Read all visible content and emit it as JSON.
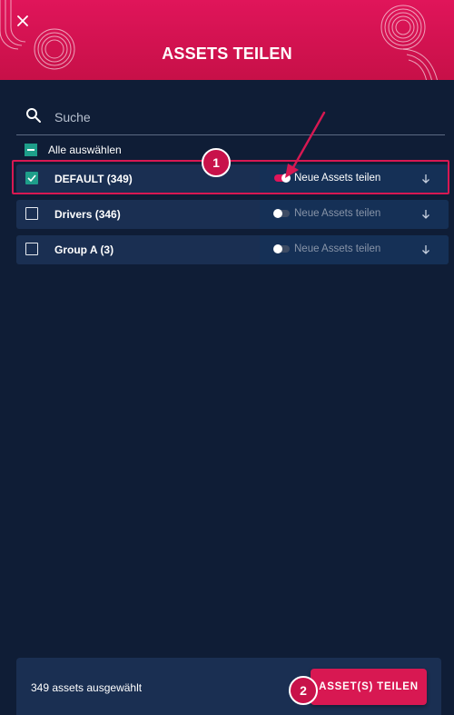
{
  "header": {
    "title": "ASSETS TEILEN",
    "close_icon": "close-icon",
    "accent": "#d81852"
  },
  "search": {
    "placeholder": "Suche",
    "value": ""
  },
  "select_all": {
    "label": "Alle auswählen",
    "state": "indeterminate"
  },
  "groups": [
    {
      "name": "DEFAULT (349)",
      "checked": true,
      "toggle_on": true,
      "toggle_label": "Neue Assets teilen"
    },
    {
      "name": "Drivers (346)",
      "checked": false,
      "toggle_on": false,
      "toggle_label": "Neue Assets teilen"
    },
    {
      "name": "Group A (3)",
      "checked": false,
      "toggle_on": false,
      "toggle_label": "Neue Assets teilen"
    }
  ],
  "annotations": {
    "step1": "1",
    "step2": "2"
  },
  "footer": {
    "count_text": "349 assets ausgewählt",
    "share_button": "ASSET(S) TEILEN"
  }
}
